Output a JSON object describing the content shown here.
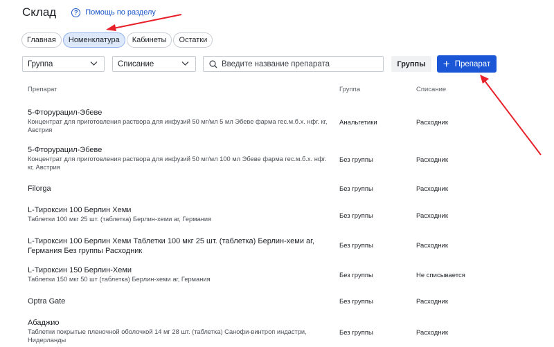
{
  "header": {
    "title": "Склад",
    "help_label": "Помощь по разделу"
  },
  "tabs": [
    {
      "label": "Главная",
      "active": false
    },
    {
      "label": "Номенклатура",
      "active": true
    },
    {
      "label": "Кабинеты",
      "active": false
    },
    {
      "label": "Остатки",
      "active": false
    }
  ],
  "filters": {
    "group_select": "Группа",
    "writeoff_select": "Списание",
    "search_placeholder": "Введите название препарата",
    "groups_button": "Группы",
    "add_button": "Препарат"
  },
  "table": {
    "columns": [
      "Препарат",
      "Группа",
      "Списание"
    ],
    "rows": [
      {
        "name": "5-Фторурацил-Эбеве",
        "desc": "Концентрат для приготовления раствора для инфузий 50 мг/мл 5 мл Эбеве фарма гес.м.б.х. нфг. кг, Австрия",
        "group": "Анальгетики",
        "writeoff": "Расходник"
      },
      {
        "name": "5-Фторурацил-Эбеве",
        "desc": "Концентрат для приготовления раствора для инфузий 50 мг/мл 100 мл Эбеве фарма гес.м.б.х. нфг. кг, Австрия",
        "group": "Без группы",
        "writeoff": "Расходник"
      },
      {
        "name": "Filorga",
        "desc": "",
        "group": "Без группы",
        "writeoff": "Расходник"
      },
      {
        "name": "L-Тироксин 100 Берлин Хеми",
        "desc": "Таблетки 100 мкг 25 шт. (таблетка) Берлин-хеми аг, Германия",
        "group": "Без группы",
        "writeoff": "Расходник"
      },
      {
        "name": "L-Тироксин 100 Берлин Хеми Таблетки 100 мкг 25 шт. (таблетка) Берлин-хеми аг, Германия Без группы Расходник",
        "desc": "",
        "group": "Без группы",
        "writeoff": "Расходник"
      },
      {
        "name": "L-Тироксин 150 Берлин-Хеми",
        "desc": "Таблетки 150 мкг 50 шт (таблетка) Берлин-хеми аг, Германия",
        "group": "Без группы",
        "writeoff": "Не списывается"
      },
      {
        "name": "Optra Gate",
        "desc": "",
        "group": "Без группы",
        "writeoff": "Расходник"
      },
      {
        "name": "Абаджио",
        "desc": "Таблетки покрытые пленочной оболочкой 14 мг 28 шт. (таблетка) Санофи-винтроп индастри, Нидерланды",
        "group": "Без группы",
        "writeoff": "Расходник"
      }
    ]
  },
  "colors": {
    "accent": "#1a56d6",
    "annotation": "#e8202a",
    "tab_active_bg": "#dde8fb"
  }
}
